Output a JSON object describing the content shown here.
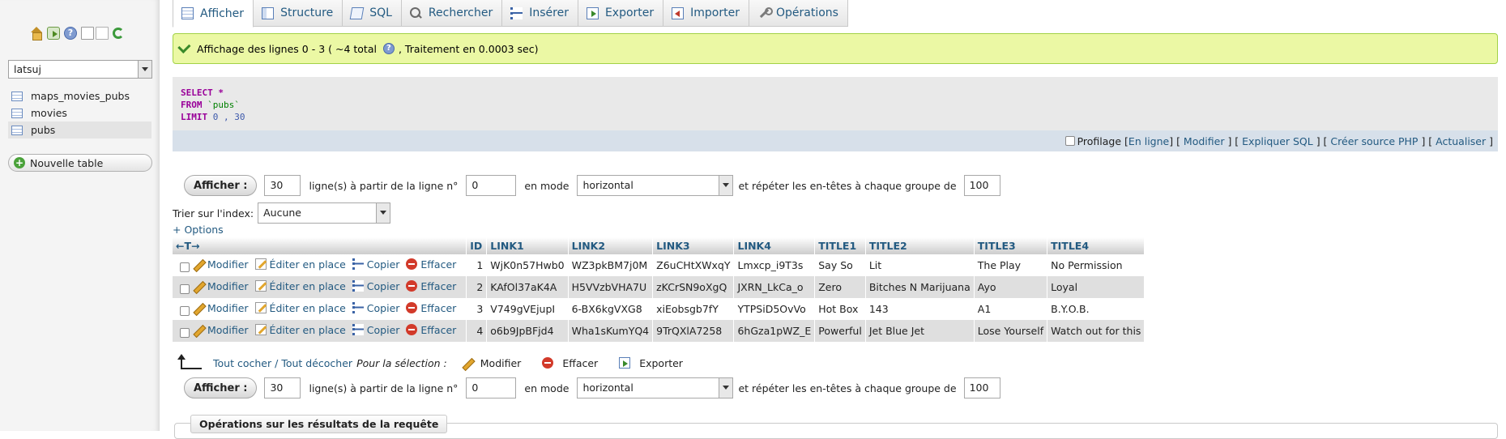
{
  "sidebar": {
    "icons": [
      "home-icon",
      "exit-icon",
      "help-icon",
      "docs-icon",
      "docs-icon",
      "reload-icon"
    ],
    "database": "latsuj",
    "tables": [
      {
        "name": "maps_movies_pubs"
      },
      {
        "name": "movies"
      },
      {
        "name": "pubs"
      }
    ],
    "new_table_label": "Nouvelle table"
  },
  "tabs": [
    {
      "label": "Afficher",
      "icon": "browse-icon"
    },
    {
      "label": "Structure",
      "icon": "structure-icon"
    },
    {
      "label": "SQL",
      "icon": "sql-icon"
    },
    {
      "label": "Rechercher",
      "icon": "search-icon"
    },
    {
      "label": "Insérer",
      "icon": "insert-icon"
    },
    {
      "label": "Exporter",
      "icon": "export-icon"
    },
    {
      "label": "Importer",
      "icon": "import-icon"
    },
    {
      "label": "Opérations",
      "icon": "operations-icon"
    }
  ],
  "message": {
    "text_before": "Affichage des lignes 0 - 3 ( ~4 total",
    "text_after": ", Traitement en 0.0003 sec)"
  },
  "query": {
    "select": "SELECT",
    "star": "*",
    "from": "FROM",
    "table": "`pubs`",
    "limit": "LIMIT",
    "limit_values": "0 , 30"
  },
  "query_actions": {
    "profiling": "Profilage",
    "inline": "En ligne",
    "edit": "Modifier",
    "explain": "Expliquer SQL",
    "php": "Créer source PHP",
    "refresh": "Actualiser"
  },
  "nav": {
    "show_button": "Afficher :",
    "rows": "30",
    "rows_label": "ligne(s) à partir de la ligne n°",
    "start": "0",
    "mode_label": "en mode",
    "mode": "horizontal",
    "repeat_label": "et répéter les en-têtes à chaque groupe de",
    "repeat": "100"
  },
  "sort": {
    "label": "Trier sur l'index:",
    "value": "Aucune"
  },
  "options_link": "+ Options",
  "table": {
    "arrows": "←T→",
    "columns": [
      "ID",
      "LINK1",
      "LINK2",
      "LINK3",
      "LINK4",
      "TITLE1",
      "TITLE2",
      "TITLE3",
      "TITLE4"
    ],
    "row_actions": {
      "edit": "Modifier",
      "inline": "Éditer en place",
      "copy": "Copier",
      "delete": "Effacer"
    },
    "rows": [
      [
        "1",
        "WjK0n57Hwb0",
        "WZ3pkBM7j0M",
        "Z6uCHtXWxqY",
        "Lmxcp_i9T3s",
        "Say So",
        "Lit",
        "The Play",
        "No Permission"
      ],
      [
        "2",
        "KAfOl37aK4A",
        "H5VVzbVHA7U",
        "zKCrSN9oXgQ",
        "JXRN_LkCa_o",
        "Zero",
        "Bitches N Marijuana",
        "Ayo",
        "Loyal"
      ],
      [
        "3",
        "V749gVEjupI",
        "6-BX6kgVXG8",
        "xiEobsgb7fY",
        "YTPSiD5OvVo",
        "Hot Box",
        "143",
        "A1",
        "B.Y.O.B."
      ],
      [
        "4",
        "o6b9JpBFjd4",
        "Wha1sKumYQ4",
        "9TrQXlA7258",
        "6hGza1pWZ_E",
        "Powerful",
        "Jet Blue Jet",
        "Lose Yourself",
        "Watch out for this"
      ]
    ]
  },
  "selection": {
    "check_all": "Tout cocher",
    "separator": "/",
    "uncheck_all": "Tout décocher",
    "for_selection": "Pour la sélection :",
    "edit": "Modifier",
    "delete": "Effacer",
    "export": "Exporter"
  },
  "operations_legend": "Opérations sur les résultats de la requête"
}
